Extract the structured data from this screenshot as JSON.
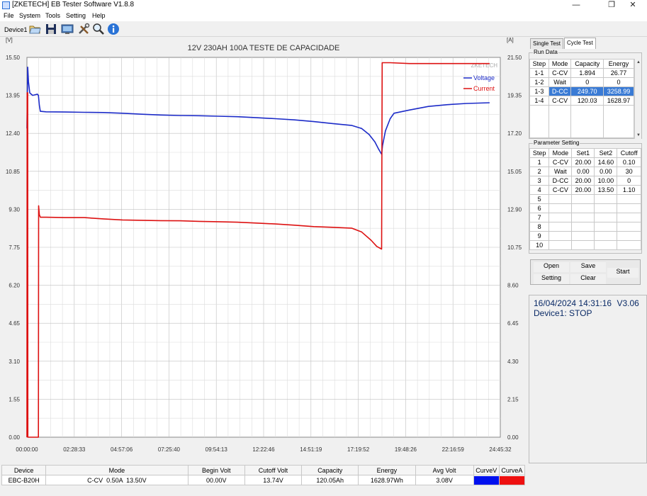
{
  "window": {
    "title": "[ZKETECH] EB Tester Software V1.8.8",
    "controls": [
      "—",
      "❐",
      "✕"
    ]
  },
  "menu": [
    "File",
    "System",
    "Tools",
    "Setting",
    "Help"
  ],
  "toolbar": {
    "device_label": "Device1",
    "icons": [
      "open-folder-icon",
      "save-disk-icon",
      "monitor-icon",
      "tools-icon",
      "zoom-icon",
      "info-icon"
    ]
  },
  "chart_data": {
    "type": "line",
    "title": "12V 230AH 100A TESTE DE CAPACIDADE",
    "watermark": "ZKETECH",
    "ylabel_left": "[V]",
    "ylabel_right": "[A]",
    "ylim_left": [
      0,
      15.5
    ],
    "ylim_right": [
      0,
      21.5
    ],
    "yticks_left": [
      "0.00",
      "1.55",
      "3.10",
      "4.65",
      "6.20",
      "7.75",
      "9.30",
      "10.85",
      "12.40",
      "13.95",
      "15.50"
    ],
    "yticks_right": [
      "0.00",
      "2.15",
      "4.30",
      "6.45",
      "8.60",
      "10.75",
      "12.90",
      "15.05",
      "17.20",
      "19.35",
      "21.50"
    ],
    "xticks": [
      "00:00:00",
      "02:28:33",
      "04:57:06",
      "07:25:40",
      "09:54:13",
      "12:22:46",
      "14:51:19",
      "17:19:52",
      "19:48:26",
      "22:16:59",
      "24:45:32"
    ],
    "x_range_hours": [
      0,
      24.759
    ],
    "grid": true,
    "legend_position": "top-right",
    "colors": {
      "voltage": "#1c2bc8",
      "current": "#dd1111"
    },
    "series": [
      {
        "name": "Voltage",
        "axis": "left",
        "points": [
          [
            0,
            12.6
          ],
          [
            0.04,
            15.1
          ],
          [
            0.08,
            14.5
          ],
          [
            0.15,
            14.05
          ],
          [
            0.3,
            13.95
          ],
          [
            0.55,
            14.0
          ],
          [
            0.6,
            13.95
          ],
          [
            0.65,
            13.55
          ],
          [
            0.7,
            13.3
          ],
          [
            1,
            13.28
          ],
          [
            2,
            13.27
          ],
          [
            3,
            13.26
          ],
          [
            4,
            13.25
          ],
          [
            5,
            13.22
          ],
          [
            6,
            13.18
          ],
          [
            7,
            13.15
          ],
          [
            8,
            13.13
          ],
          [
            9,
            13.12
          ],
          [
            10,
            13.1
          ],
          [
            11,
            13.08
          ],
          [
            12,
            13.04
          ],
          [
            13,
            13.0
          ],
          [
            14,
            12.95
          ],
          [
            15,
            12.88
          ],
          [
            16,
            12.8
          ],
          [
            17,
            12.72
          ],
          [
            17.5,
            12.6
          ],
          [
            17.9,
            12.35
          ],
          [
            18.2,
            12.05
          ],
          [
            18.4,
            11.75
          ],
          [
            18.55,
            11.55
          ],
          [
            18.6,
            11.9
          ],
          [
            18.75,
            12.5
          ],
          [
            19,
            13.0
          ],
          [
            19.2,
            13.22
          ],
          [
            20,
            13.35
          ],
          [
            21,
            13.5
          ],
          [
            22,
            13.57
          ],
          [
            23,
            13.62
          ],
          [
            24.2,
            13.65
          ]
        ]
      },
      {
        "name": "Current",
        "axis": "right",
        "points": [
          [
            0,
            0
          ],
          [
            0.01,
            19.5
          ],
          [
            0.04,
            19.5
          ],
          [
            0.05,
            0
          ],
          [
            0.6,
            0
          ],
          [
            0.61,
            13.1
          ],
          [
            0.65,
            12.6
          ],
          [
            0.7,
            12.45
          ],
          [
            1,
            12.45
          ],
          [
            2,
            12.43
          ],
          [
            3,
            12.43
          ],
          [
            4,
            12.36
          ],
          [
            5,
            12.3
          ],
          [
            6,
            12.28
          ],
          [
            7,
            12.26
          ],
          [
            8,
            12.25
          ],
          [
            9,
            12.22
          ],
          [
            10,
            12.2
          ],
          [
            11,
            12.17
          ],
          [
            12,
            12.12
          ],
          [
            13,
            12.07
          ],
          [
            14,
            12.0
          ],
          [
            15,
            11.92
          ],
          [
            16,
            11.88
          ],
          [
            17,
            11.83
          ],
          [
            17.5,
            11.62
          ],
          [
            18,
            11.15
          ],
          [
            18.3,
            10.8
          ],
          [
            18.55,
            10.65
          ],
          [
            18.58,
            21.2
          ],
          [
            19,
            21.2
          ],
          [
            20,
            21.15
          ],
          [
            24.2,
            21.15
          ]
        ]
      }
    ]
  },
  "tabs": [
    "Single Test",
    "Cycle Test"
  ],
  "run_data": {
    "title": "Run Data",
    "headers": [
      "Step",
      "Mode",
      "Capacity",
      "Energy"
    ],
    "rows": [
      [
        "1-1",
        "C-CV",
        "1.894",
        "26.77"
      ],
      [
        "1-2",
        "Wait",
        "0",
        "0"
      ],
      [
        "1-3",
        "D-CC",
        "249.70",
        "3258.99"
      ],
      [
        "1-4",
        "C-CV",
        "120.03",
        "1628.97"
      ]
    ],
    "selected_row": 2
  },
  "parameter_setting": {
    "title": "Parameter Setting",
    "headers": [
      "Step",
      "Mode",
      "Set1",
      "Set2",
      "Cutoff"
    ],
    "rows": [
      [
        "1",
        "C-CV",
        "20.00",
        "14.60",
        "0.10"
      ],
      [
        "2",
        "Wait",
        "0.00",
        "0.00",
        "30"
      ],
      [
        "3",
        "D-CC",
        "20.00",
        "10.00",
        "0"
      ],
      [
        "4",
        "C-CV",
        "20.00",
        "13.50",
        "1.10"
      ],
      [
        "5",
        "",
        "",
        "",
        ""
      ],
      [
        "6",
        "",
        "",
        "",
        ""
      ],
      [
        "7",
        "",
        "",
        "",
        ""
      ],
      [
        "8",
        "",
        "",
        "",
        ""
      ],
      [
        "9",
        "",
        "",
        "",
        ""
      ],
      [
        "10",
        "",
        "",
        "",
        ""
      ]
    ]
  },
  "buttons": {
    "open": "Open",
    "save": "Save",
    "setting": "Setting",
    "clear": "Clear",
    "start": "Start"
  },
  "status": {
    "datetime": "16/04/2024 14:31:16",
    "version": "V3.06",
    "device_state": "Device1: STOP"
  },
  "summary": {
    "headers": [
      "Device",
      "Mode",
      "Begin Volt",
      "Cutoff Volt",
      "Capacity",
      "Energy",
      "Avg Volt",
      "CurveV",
      "CurveA"
    ],
    "values": [
      "EBC-B20H",
      "C-CV  0.50A  13.50V",
      "00.00V",
      "13.74V",
      "120.05Ah",
      "1628.97Wh",
      "3.08V"
    ],
    "curve_colors": [
      "#0010ee",
      "#ee1010"
    ]
  }
}
